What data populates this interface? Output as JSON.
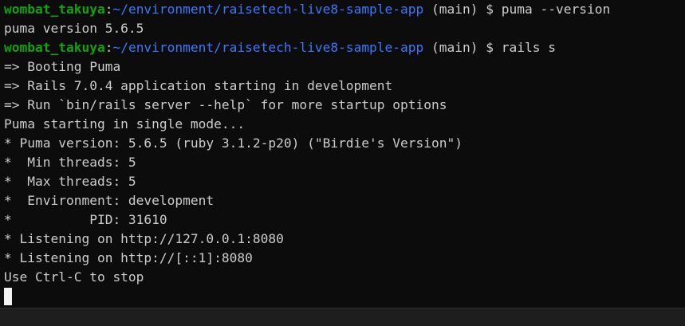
{
  "terminal": {
    "colors": {
      "background": "#0c0c0c",
      "text": "#cccccc",
      "user": "#13a10e",
      "path": "#3b78ff",
      "cursor": "#f2f2f2"
    },
    "prompts": [
      {
        "user": "wombat_takuya",
        "sep": ":",
        "path": "~/environment/raisetech-live8-sample-app",
        "branch": " (main)",
        "symbol": " $ ",
        "command": "puma --version"
      },
      {
        "user": "wombat_takuya",
        "sep": ":",
        "path": "~/environment/raisetech-live8-sample-app",
        "branch": " (main)",
        "symbol": " $ ",
        "command": "rails s"
      }
    ],
    "output": {
      "puma_version": "puma version 5.6.5",
      "server_lines": [
        "=> Booting Puma",
        "=> Rails 7.0.4 application starting in development",
        "=> Run `bin/rails server --help` for more startup options",
        "Puma starting in single mode...",
        "* Puma version: 5.6.5 (ruby 3.1.2-p20) (\"Birdie's Version\")",
        "*  Min threads: 5",
        "*  Max threads: 5",
        "*  Environment: development",
        "*          PID: 31610",
        "* Listening on http://127.0.0.1:8080",
        "* Listening on http://[::1]:8080",
        "Use Ctrl-C to stop"
      ]
    }
  }
}
